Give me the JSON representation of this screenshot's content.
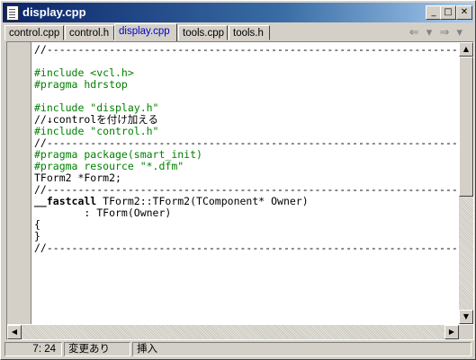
{
  "window": {
    "title": "display.cpp"
  },
  "title_buttons": {
    "minimize": "_",
    "maximize": "□",
    "close": "✕"
  },
  "tabs": [
    {
      "label": "control.cpp",
      "active": false
    },
    {
      "label": "control.h",
      "active": false
    },
    {
      "label": "display.cpp",
      "active": true
    },
    {
      "label": "tools.cpp",
      "active": false
    },
    {
      "label": "tools.h",
      "active": false
    }
  ],
  "nav_arrows": "⇐ ▾ ⇒ ▾",
  "code_lines": [
    "//---------------------------------------------------------------------------",
    "",
    "#include <vcl.h>",
    "#pragma hdrstop",
    "",
    "#include \"display.h\"",
    "//↓controlを付け加える",
    "#include \"control.h\"",
    "//---------------------------------------------------------------------------",
    "#pragma package(smart_init)",
    "#pragma resource \"*.dfm\"",
    "TForm2 *Form2;",
    "//---------------------------------------------------------------------------",
    "__fastcall TForm2::TForm2(TComponent* Owner)",
    "        : TForm(Owner)",
    "{",
    "}",
    "//---------------------------------------------------------------------------"
  ],
  "status": {
    "position": "7: 24",
    "modified": "変更あり",
    "mode": "挿入"
  },
  "colors": {
    "titlebar_start": "#0a246a",
    "titlebar_end": "#a6caf0",
    "preprocessor": "#008000",
    "active_tab": "#0000cc"
  }
}
